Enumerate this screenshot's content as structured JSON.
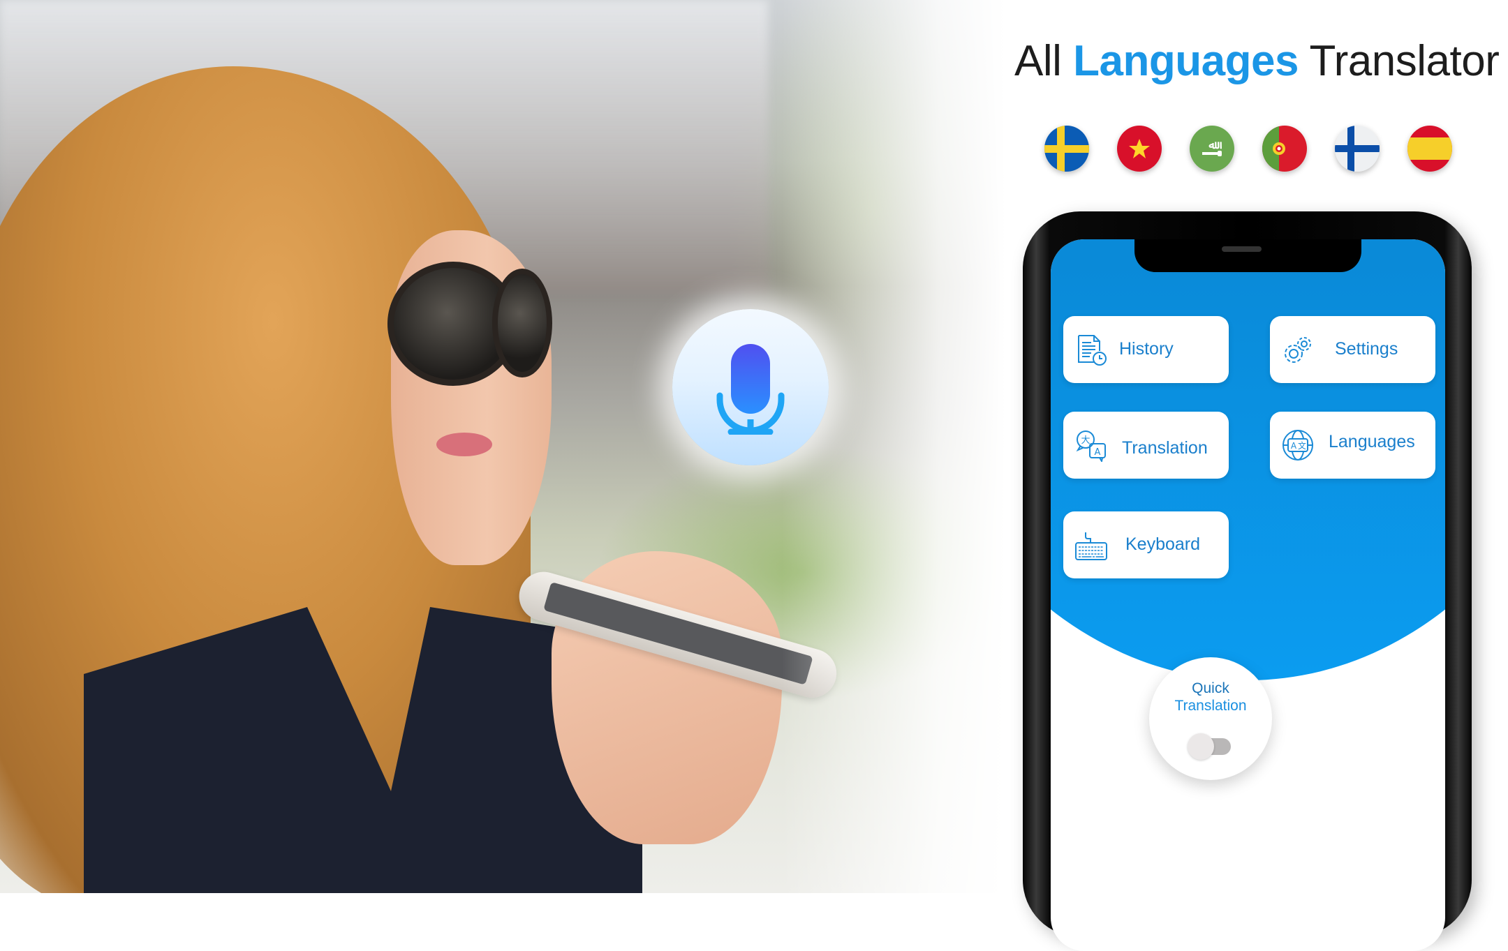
{
  "headline": {
    "prefix": "All",
    "accent": "Languages",
    "suffix": "Translator",
    "accent_color": "#1b96e6"
  },
  "flags": [
    {
      "name": "Sweden",
      "icon": "flag-sweden-icon"
    },
    {
      "name": "Vietnam",
      "icon": "flag-vietnam-icon"
    },
    {
      "name": "Saudi Arabia",
      "icon": "flag-saudi-arabia-icon"
    },
    {
      "name": "Portugal",
      "icon": "flag-portugal-icon"
    },
    {
      "name": "Finland",
      "icon": "flag-finland-icon"
    },
    {
      "name": "Spain",
      "icon": "flag-spain-icon"
    }
  ],
  "voice_bubble": {
    "icon": "microphone-icon"
  },
  "app": {
    "theme_color": "#0a8ad8",
    "menu": [
      {
        "label": "History",
        "icon": "history-document-clock-icon"
      },
      {
        "label": "Settings",
        "icon": "gears-icon"
      },
      {
        "label": "Translation",
        "icon": "translate-speech-bubbles-icon"
      },
      {
        "label": "Languages",
        "icon": "globe-translate-icon"
      },
      {
        "label": "Keyboard",
        "icon": "keyboard-icon"
      }
    ],
    "quick_translation": {
      "line1": "Quick",
      "line2": "Translation",
      "enabled": false
    }
  }
}
